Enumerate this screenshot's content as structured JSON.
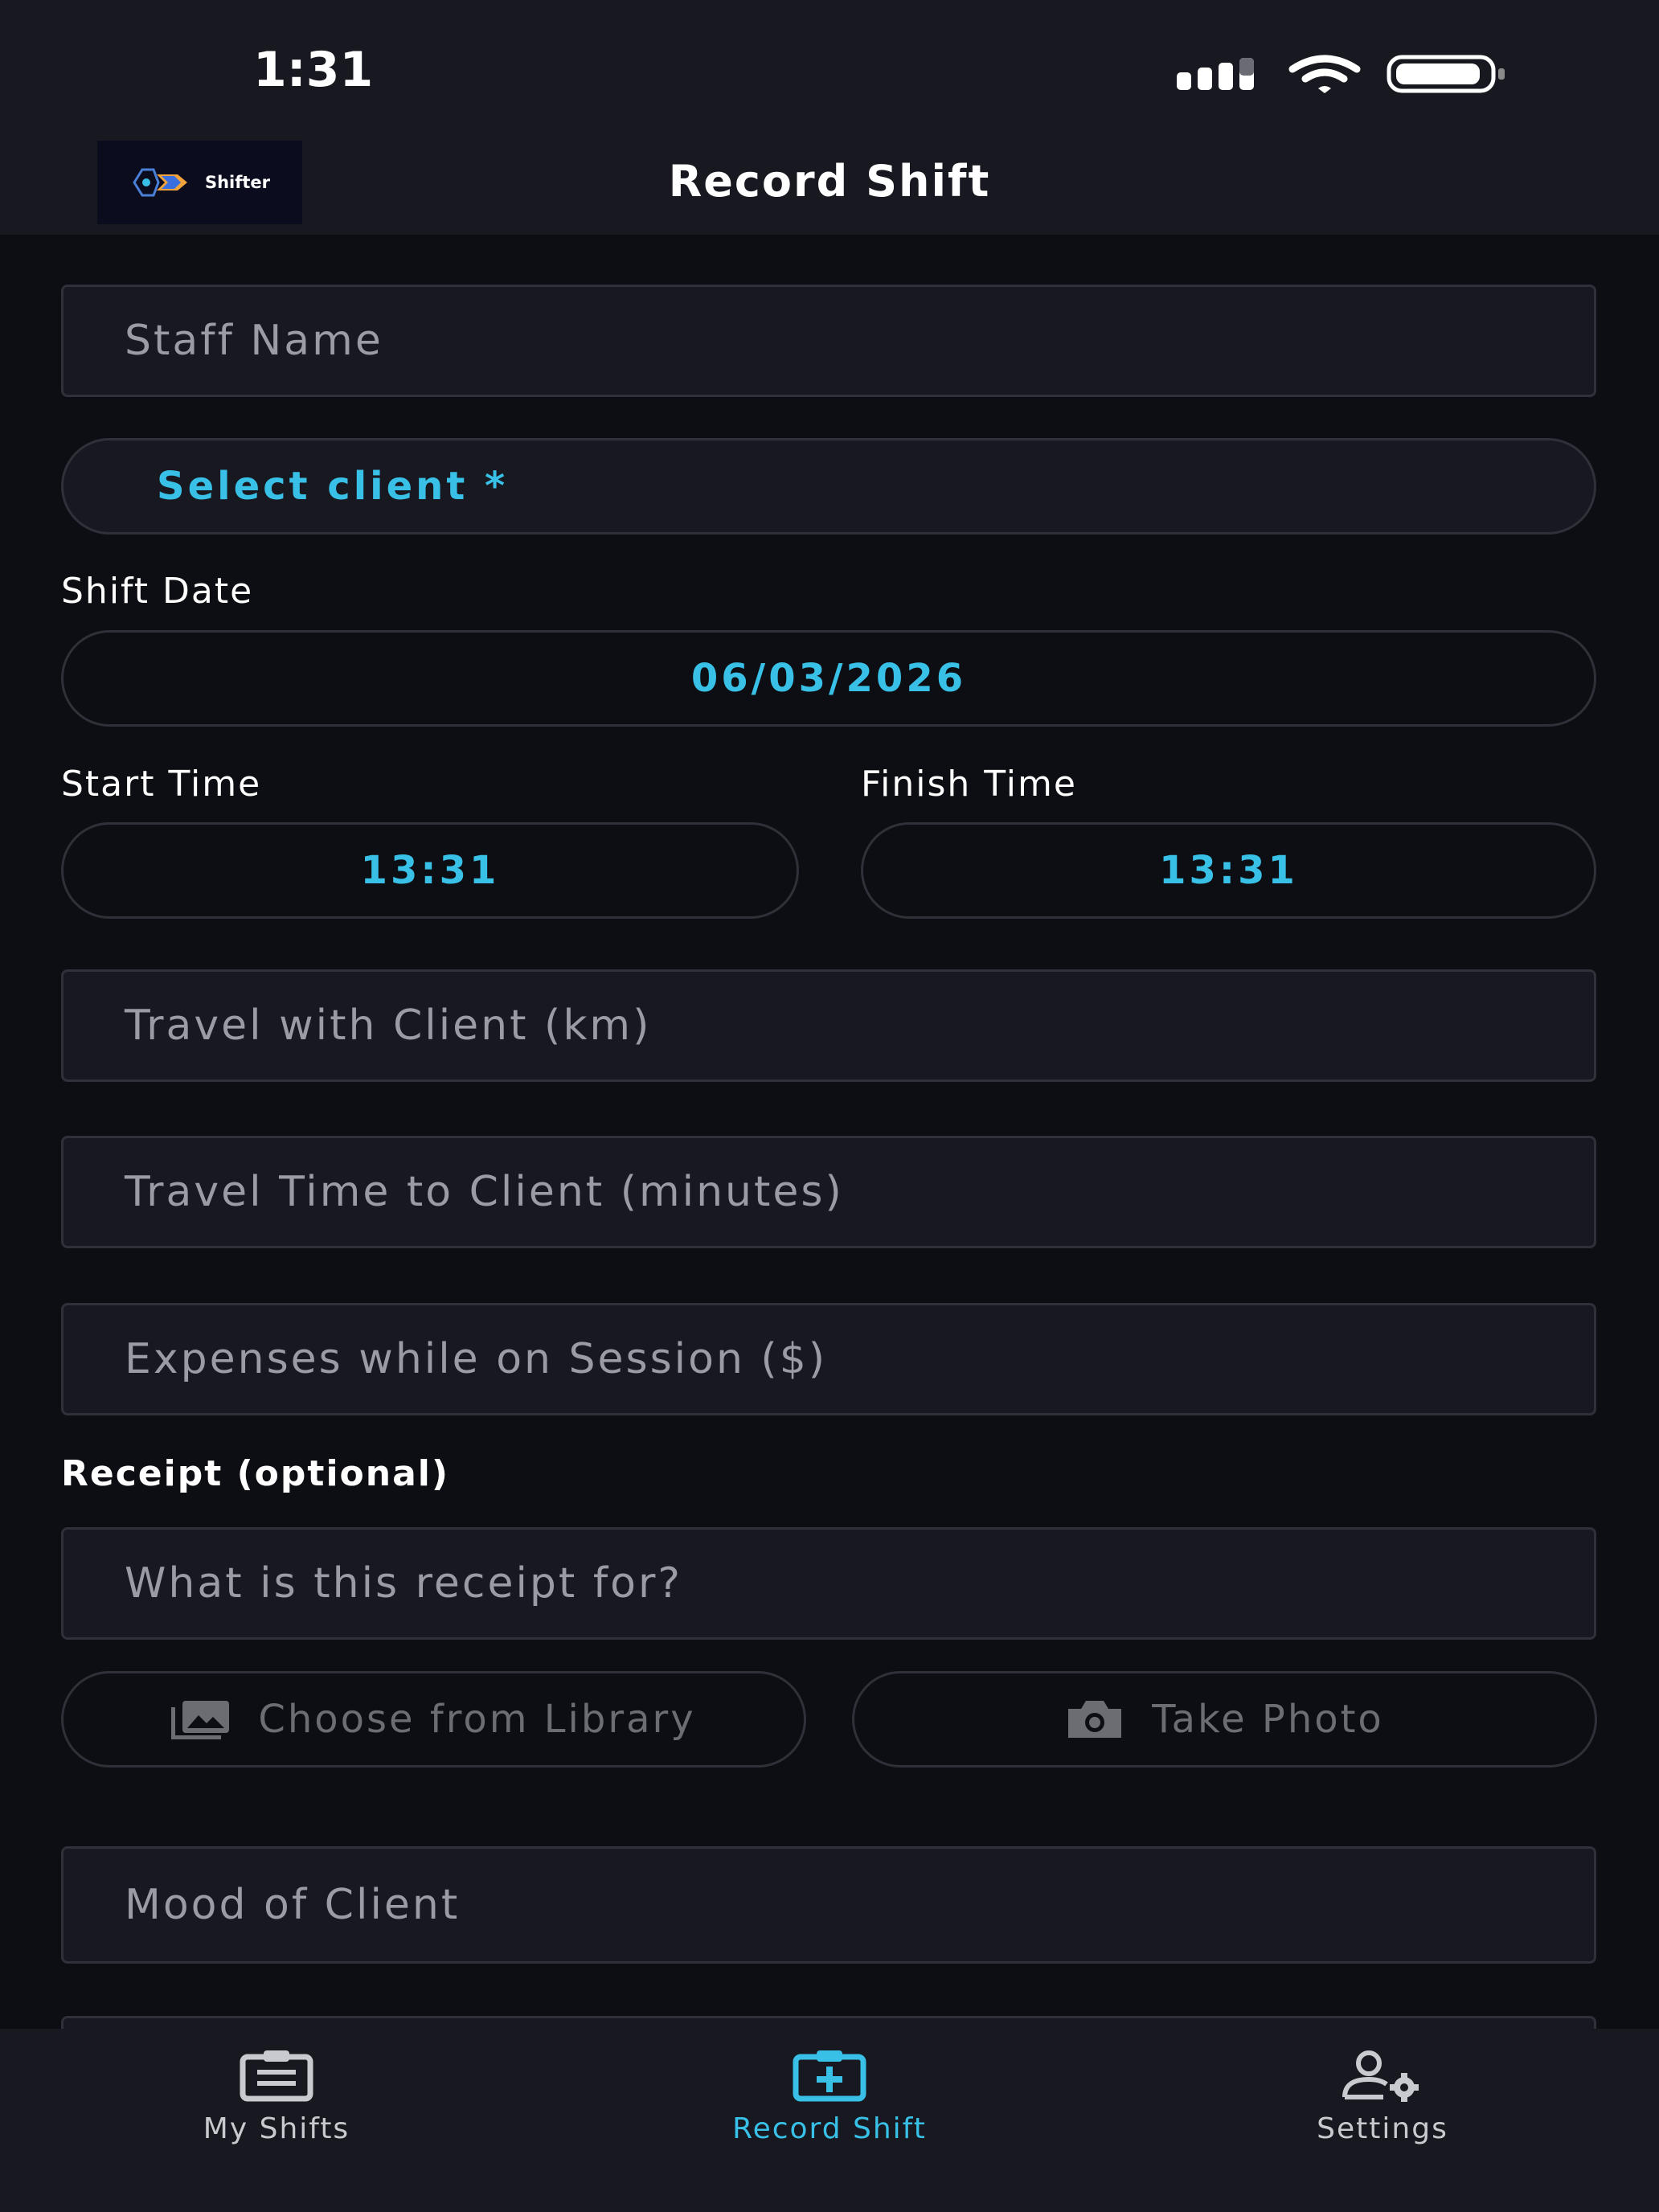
{
  "status_bar": {
    "time": "1:31"
  },
  "header": {
    "title": "Record Shift",
    "logo_text": "Shifter"
  },
  "form": {
    "staff_name_placeholder": "Staff Name",
    "select_client": "Select client *",
    "shift_date_label": "Shift Date",
    "shift_date_value": "06/03/2026",
    "start_time_label": "Start Time",
    "start_time_value": "13:31",
    "finish_time_label": "Finish Time",
    "finish_time_value": "13:31",
    "travel_with_client_placeholder": "Travel with Client (km)",
    "travel_time_placeholder": "Travel Time to Client (minutes)",
    "expenses_placeholder": "Expenses while on Session ($)",
    "receipt_label": "Receipt (optional)",
    "receipt_for_placeholder": "What is this receipt for?",
    "choose_library_label": "Choose from Library",
    "take_photo_label": "Take Photo",
    "mood_placeholder": "Mood of Client"
  },
  "tabs": [
    {
      "label": "My Shifts",
      "icon": "clipboard-icon"
    },
    {
      "label": "Record Shift",
      "icon": "medical-case-icon"
    },
    {
      "label": "Settings",
      "icon": "user-gear-icon"
    }
  ],
  "colors": {
    "accent": "#38c0e6",
    "background": "#0d0e13",
    "surface": "#171820"
  }
}
